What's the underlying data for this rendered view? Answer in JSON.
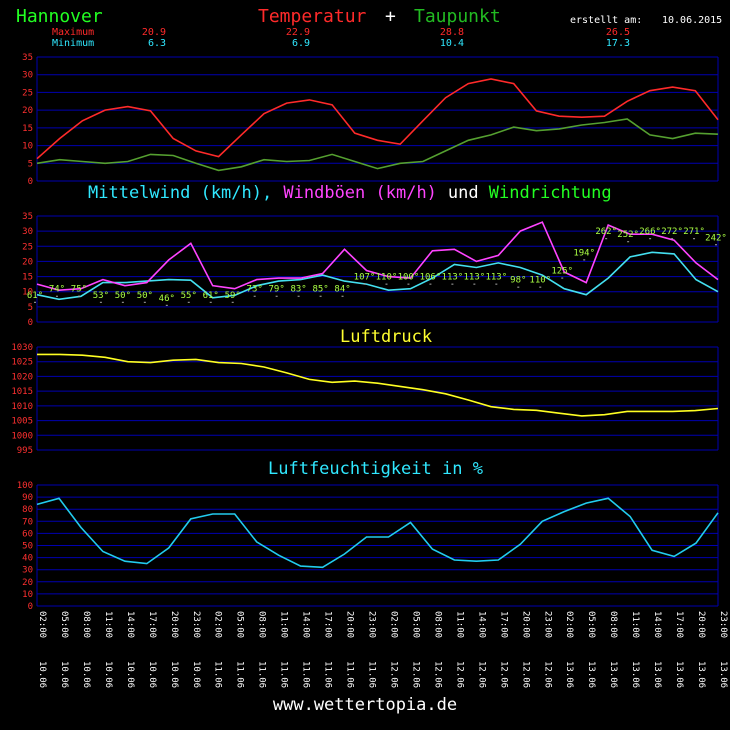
{
  "header": {
    "city": "Hannover",
    "title_temp": "Temperatur",
    "title_plus": "+",
    "title_dew": "Taupunkt",
    "created_label": "erstellt am:",
    "created_date": "10.06.2015",
    "max_label": "Maximum",
    "min_label": "Minimum",
    "max_values": [
      "20.9",
      "22.9",
      "28.8",
      "26.5"
    ],
    "min_values": [
      "6.3",
      "6.9",
      "10.4",
      "17.3"
    ]
  },
  "colors": {
    "temp": "#ff2a2a",
    "dew": "#55a030",
    "wind_mean": "#44e0f0",
    "wind_gust": "#ff44ff",
    "wind_dir": "#aaff44",
    "pressure": "#ffff22",
    "humidity": "#22ccee",
    "grid": "#0000b0",
    "axis_text": "#ff3030",
    "yellow_text": "#ffff30",
    "cyan_text": "#30e8ff"
  },
  "footer": {
    "url": "www.wettertopia.de"
  },
  "chart_data": [
    {
      "type": "line",
      "title": "",
      "ylim": [
        0,
        35
      ],
      "yticks": [
        0,
        5,
        10,
        15,
        20,
        25,
        30,
        35
      ],
      "series": [
        {
          "name": "Temperatur",
          "color_key": "temp",
          "values": [
            6.3,
            12,
            17,
            20,
            21,
            19.8,
            12,
            8.5,
            6.9,
            13,
            19,
            22,
            22.9,
            21.5,
            13.5,
            11.5,
            10.4,
            17,
            23.5,
            27.5,
            28.8,
            27.5,
            19.8,
            18.3,
            18,
            18.3,
            22.5,
            25.5,
            26.5,
            25.5,
            17.3
          ]
        },
        {
          "name": "Taupunkt",
          "color_key": "dew",
          "values": [
            5,
            6,
            5.5,
            5,
            5.5,
            7.5,
            7.2,
            5,
            3,
            4,
            6,
            5.5,
            5.8,
            7.5,
            5.5,
            3.5,
            5,
            5.5,
            8.5,
            11.5,
            13,
            15.2,
            14.2,
            14.7,
            15.8,
            16.5,
            17.5,
            13,
            12,
            13.5,
            13.2
          ]
        }
      ]
    },
    {
      "type": "line",
      "title_parts": [
        "Mittelwind (km/h),",
        "Windböen (km/h)",
        "und",
        "Windrichtung"
      ],
      "ylim": [
        0,
        35
      ],
      "yticks": [
        0,
        5,
        10,
        15,
        20,
        25,
        30,
        35
      ],
      "series": [
        {
          "name": "Mittelwind (km/h)",
          "color_key": "wind_mean",
          "values": [
            9,
            7.5,
            8.5,
            13,
            13,
            13.5,
            14,
            13.8,
            8,
            8.8,
            12,
            13.5,
            14,
            15.5,
            13.5,
            12.5,
            10.5,
            11,
            14.5,
            19,
            18,
            19.5,
            18,
            15.5,
            11,
            9,
            14.5,
            21.5,
            23,
            22.5,
            14,
            10
          ]
        },
        {
          "name": "Windböen (km/h)",
          "color_key": "wind_gust",
          "values": [
            12.5,
            10.5,
            11,
            14,
            12,
            13,
            20.5,
            26,
            12,
            11,
            14,
            14.5,
            14.5,
            16,
            24,
            17,
            15,
            14.5,
            23.5,
            24,
            20,
            22,
            30,
            33,
            16.5,
            13,
            32,
            29,
            29,
            27,
            19.5,
            14
          ]
        },
        {
          "name": "Windrichtung",
          "color_key": "wind_dir",
          "labels": [
            "61°",
            "74°",
            "75°",
            "53°",
            "50°",
            "50°",
            "46°",
            "55°",
            "61°",
            "59°",
            "73°",
            "79°",
            "83°",
            "85°",
            "84°",
            "107°",
            "110°",
            "100°",
            "106°",
            "113°",
            "113°",
            "113°",
            "98°",
            "110°",
            "125°",
            "194°",
            "262°",
            "252°",
            "266°",
            "272°",
            "271°",
            "242°"
          ],
          "label_heights": [
            7,
            9,
            9,
            7,
            7,
            7,
            6,
            7,
            7,
            7,
            9,
            9,
            9,
            9,
            9,
            13,
            13,
            13,
            13,
            13,
            13,
            13,
            12,
            12,
            15,
            21,
            28,
            27,
            28,
            28,
            28,
            26
          ]
        }
      ]
    },
    {
      "type": "line",
      "title": "Luftdruck",
      "ylim": [
        995,
        1030
      ],
      "yticks": [
        995,
        1000,
        1005,
        1010,
        1015,
        1020,
        1025,
        1030
      ],
      "series": [
        {
          "name": "Luftdruck",
          "color_key": "pressure",
          "values": [
            1027.5,
            1027.5,
            1027.2,
            1026.5,
            1025,
            1024.7,
            1025.5,
            1025.8,
            1024.7,
            1024.4,
            1023.2,
            1021.2,
            1019,
            1018,
            1018.4,
            1017.7,
            1016.6,
            1015.5,
            1014.1,
            1012,
            1009.7,
            1008.8,
            1008.5,
            1007.5,
            1006.6,
            1007,
            1008.1,
            1008.1,
            1008.1,
            1008.4,
            1009.1
          ]
        }
      ]
    },
    {
      "type": "line",
      "title": "Luftfeuchtigkeit in %",
      "ylim": [
        0,
        100
      ],
      "yticks": [
        0,
        10,
        20,
        30,
        40,
        50,
        60,
        70,
        80,
        90,
        100
      ],
      "x": [
        "10.06 02:00",
        "10.06 05:00",
        "10.06 08:00",
        "10.06 11:00",
        "10.06 14:00",
        "10.06 17:00",
        "10.06 20:00",
        "10.06 23:00",
        "11.06 02:00",
        "11.06 05:00",
        "11.06 08:00",
        "11.06 11:00",
        "11.06 14:00",
        "11.06 17:00",
        "11.06 20:00",
        "11.06 23:00",
        "12.06 02:00",
        "12.06 05:00",
        "12.06 08:00",
        "12.06 11:00",
        "12.06 14:00",
        "12.06 17:00",
        "12.06 20:00",
        "12.06 23:00",
        "13.06 02:00",
        "13.06 05:00",
        "13.06 08:00",
        "13.06 11:00",
        "13.06 14:00",
        "13.06 17:00",
        "13.06 20:00",
        "13.06 23:00"
      ],
      "series": [
        {
          "name": "Luftfeuchtigkeit",
          "color_key": "humidity",
          "values": [
            84,
            89,
            65,
            45,
            37,
            35,
            48,
            72,
            76,
            76,
            53,
            42,
            33,
            32,
            43,
            57,
            57,
            69,
            47,
            38,
            37,
            38,
            51,
            70,
            78,
            85,
            89,
            74,
            46,
            41,
            52,
            77
          ]
        }
      ]
    }
  ]
}
